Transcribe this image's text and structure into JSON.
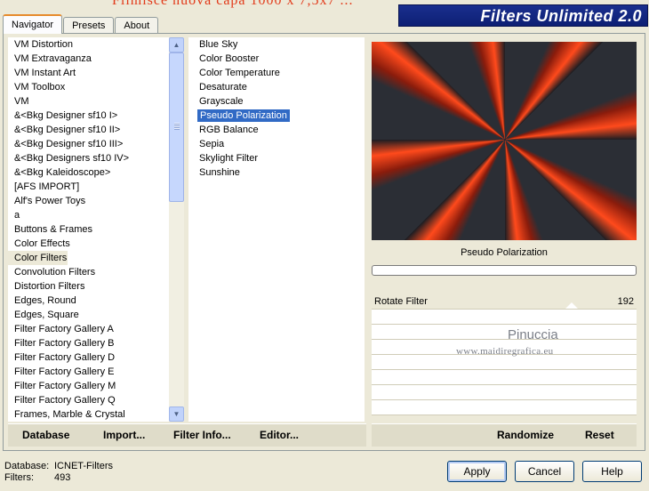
{
  "overlay_text": "Filmisce nuova capa 1000 x 7,5x7 ...",
  "brand_title": "Filters Unlimited 2.0",
  "tabs": [
    {
      "label": "Navigator"
    },
    {
      "label": "Presets"
    },
    {
      "label": "About"
    }
  ],
  "categories": [
    "VM Distortion",
    "VM Extravaganza",
    "VM Instant Art",
    "VM Toolbox",
    "VM",
    "&<Bkg Designer sf10 I>",
    "&<Bkg Designer sf10 II>",
    "&<Bkg Designer sf10 III>",
    "&<Bkg Designers sf10 IV>",
    "&<Bkg Kaleidoscope>",
    "[AFS IMPORT]",
    "Alf's Power Toys",
    "a",
    "Buttons & Frames",
    "Color Effects",
    "Color Filters",
    "Convolution Filters",
    "Distortion Filters",
    "Edges, Round",
    "Edges, Square",
    "Filter Factory Gallery A",
    "Filter Factory Gallery B",
    "Filter Factory Gallery D",
    "Filter Factory Gallery E",
    "Filter Factory Gallery M",
    "Filter Factory Gallery Q",
    "Frames, Marble & Crystal"
  ],
  "selected_category": "Color Filters",
  "filters": [
    "Blue Sky",
    "Color Booster",
    "Color Temperature",
    "Desaturate",
    "Grayscale",
    "Pseudo Polarization",
    "RGB Balance",
    "Sepia",
    "Skylight Filter",
    "Sunshine"
  ],
  "selected_filter": "Pseudo Polarization",
  "preview_name": "Pseudo Polarization",
  "parameters": [
    {
      "label": "Rotate Filter",
      "value": "192"
    }
  ],
  "watermark": {
    "line1": "Pinuccia",
    "line2": "www.maidiregrafica.eu"
  },
  "left_buttons": {
    "database": "Database",
    "import": "Import...",
    "filter_info": "Filter Info...",
    "editor": "Editor..."
  },
  "right_buttons": {
    "randomize": "Randomize",
    "reset": "Reset"
  },
  "info": {
    "db_key": "Database:",
    "db_val": "ICNET-Filters",
    "filters_key": "Filters:",
    "filters_val": "493"
  },
  "dialog": {
    "apply": "Apply",
    "cancel": "Cancel",
    "help": "Help"
  },
  "colors": {
    "brand_bg": "#1a2f8e",
    "selection": "#316ac5",
    "accent_red": "#ff4a1c"
  }
}
